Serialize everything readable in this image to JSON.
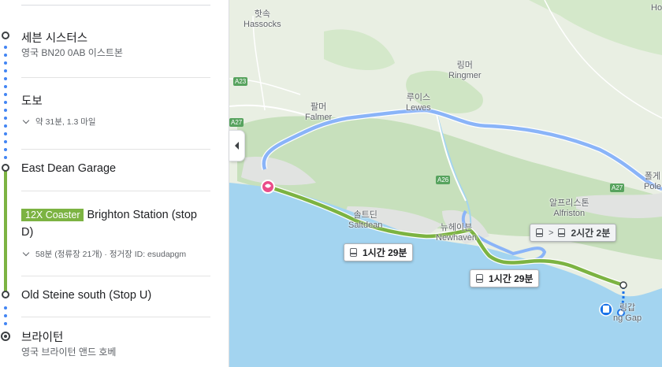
{
  "colors": {
    "sea": "#a3d4f0",
    "land": "#e9efe3",
    "green_area": "#c7e0bc",
    "walk_line": "#4285f4",
    "bus_line": "#7cb342",
    "alt_route": "#8ab4f8"
  },
  "steps": {
    "origin": {
      "title": "세븐 시스터스",
      "address": "영국 BN20 0AB 이스트본"
    },
    "walk": {
      "title": "도보",
      "detail": "약 31분, 1.3 마일"
    },
    "board_stop": {
      "title": "East Dean Garage"
    },
    "bus": {
      "route": "12X Coaster",
      "destination": "Brighton Station (stop",
      "destination_cont": "D)",
      "detail": "58분 (정류장 21개) · 정거장 ID: esudapgm"
    },
    "alight_stop": {
      "title": "Old Steine south (Stop U)"
    },
    "destination": {
      "title": "브라이턴",
      "address": "영국 브라이턴 앤드 호베"
    }
  },
  "map": {
    "places": {
      "hassocks_ko": "핫속",
      "hassocks": "Hassocks",
      "ringmer_ko": "링머",
      "ringmer": "Ringmer",
      "falmer_ko": "팔머",
      "falmer": "Falmer",
      "lewes_ko": "루이스",
      "lewes": "Lewes",
      "saltdean_ko": "솔트딘",
      "saltdean": "Saltdean",
      "newhaven_ko": "뉴헤이븐",
      "newhaven": "Newhaven",
      "alfriston_ko": "알프리스톤",
      "alfriston": "Alfriston",
      "polegate_ko": "폴게",
      "polegate": "Pole",
      "birling_ko": "링갑",
      "birling": "ng Gap",
      "edge_ho": "Ho"
    },
    "roads": {
      "a23": "A23",
      "a27": "A27",
      "a26": "A26",
      "a27_east": "A27"
    },
    "callouts": {
      "main": "1시간 29분",
      "secondary": "1시간 29분",
      "alt": "2시간 2분"
    }
  }
}
